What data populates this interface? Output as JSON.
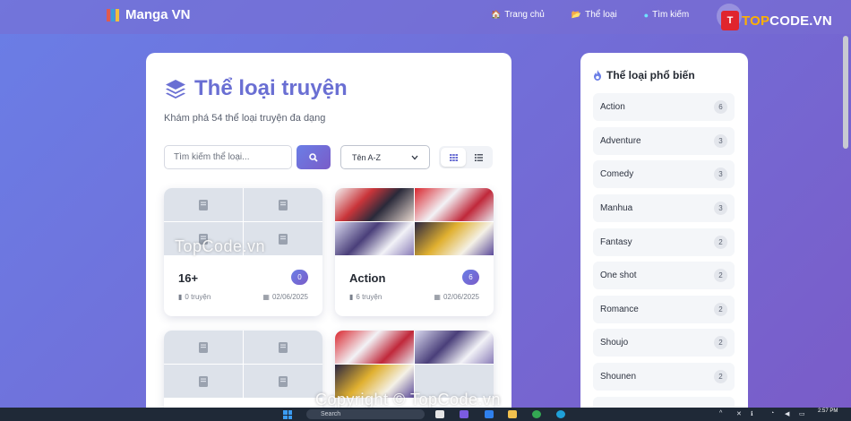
{
  "header": {
    "brand": "Manga VN",
    "nav": [
      {
        "label": "Trang chủ",
        "icon": "home-icon"
      },
      {
        "label": "Thể loại",
        "icon": "folder-icon"
      },
      {
        "label": "Tìm kiếm",
        "icon": "search-icon"
      }
    ],
    "logo_prefix": "TOP",
    "logo_suffix": "CODE.VN"
  },
  "main": {
    "title": "Thể loại truyện",
    "subtitle": "Khám phá 54 thể loại truyện đa dạng",
    "search": {
      "placeholder": "Tìm kiếm thể loại...",
      "value": ""
    },
    "sort": {
      "selected": "Tên A-Z"
    },
    "view_modes": [
      "grid",
      "list"
    ],
    "cards": [
      {
        "name": "16+",
        "count": "0",
        "stories": "0 truyện",
        "date": "02/06/2025",
        "has_images": false
      },
      {
        "name": "Action",
        "count": "6",
        "stories": "6 truyện",
        "date": "02/06/2025",
        "has_images": true
      },
      {
        "name": "",
        "count": "",
        "stories": "",
        "date": "",
        "has_images": false
      },
      {
        "name": "",
        "count": "",
        "stories": "",
        "date": "",
        "has_images": true
      }
    ]
  },
  "sidebar": {
    "title": "Thể loại phổ biến",
    "items": [
      {
        "label": "Action",
        "count": "6"
      },
      {
        "label": "Adventure",
        "count": "3"
      },
      {
        "label": "Comedy",
        "count": "3"
      },
      {
        "label": "Manhua",
        "count": "3"
      },
      {
        "label": "Fantasy",
        "count": "2"
      },
      {
        "label": "One shot",
        "count": "2"
      },
      {
        "label": "Romance",
        "count": "2"
      },
      {
        "label": "Shoujo",
        "count": "2"
      },
      {
        "label": "Shounen",
        "count": "2"
      }
    ]
  },
  "watermarks": {
    "top": "TopCode.vn",
    "bottom": "Copyright © TopCode.vn"
  },
  "taskbar": {
    "search": "Search",
    "time": "2:57 PM"
  },
  "colors": {
    "accent_start": "#6a7ee6",
    "accent_end": "#7a5cc8",
    "title": "#6a6fd3"
  }
}
